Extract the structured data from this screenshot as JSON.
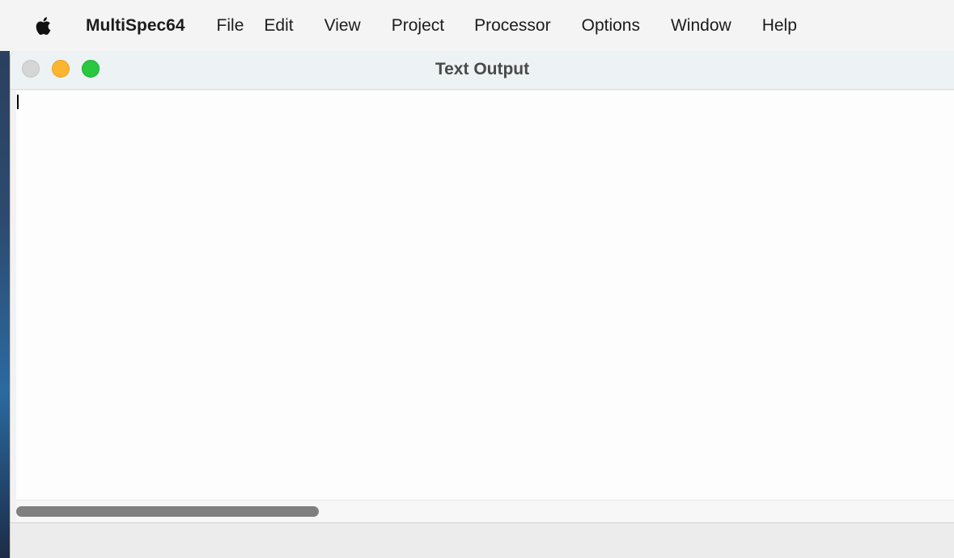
{
  "menubar": {
    "app_name": "MultiSpec64",
    "items": [
      "File",
      "Edit",
      "View",
      "Project",
      "Processor",
      "Options",
      "Window",
      "Help"
    ],
    "icons": [
      "apple-icon"
    ]
  },
  "window": {
    "title": "Text Output",
    "traffic_lights": {
      "close_color": "#d6d6d6",
      "minimize_color": "#fbb52f",
      "zoom_color": "#28c840"
    },
    "text_content": ""
  },
  "colors": {
    "menubar_bg": "#f4f4f4",
    "titlebar_bg": "#edf2f4",
    "scroll_thumb": "#7f7f7f"
  }
}
